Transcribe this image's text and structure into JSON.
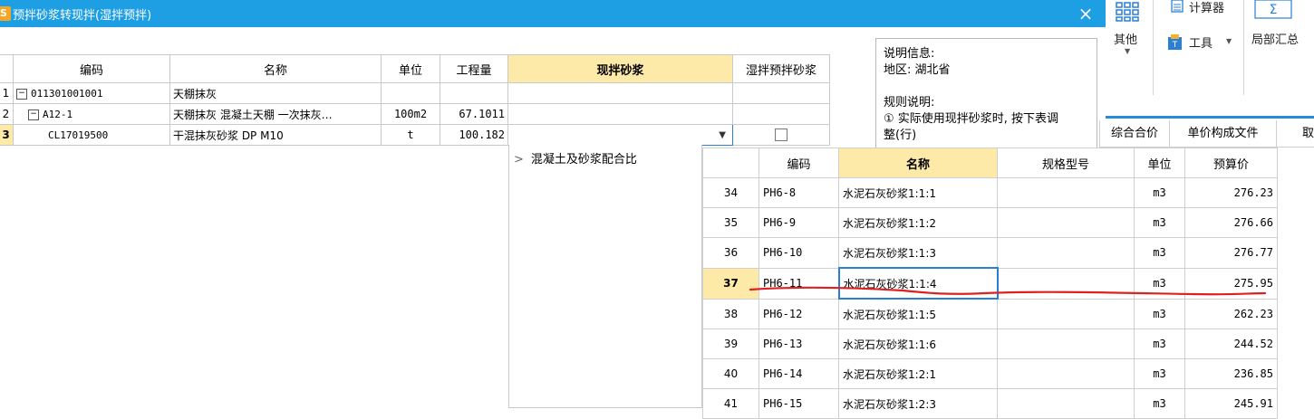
{
  "dialog": {
    "title": "预拌砂浆转现拌(湿拌预拌)",
    "close_glyph": "×"
  },
  "ribbon": {
    "other_label": "其他",
    "calculator_label": "计算器",
    "tools_label": "工具",
    "local_summary_label": "局部汇总"
  },
  "tabs": [
    "综合合价",
    "单价构成文件",
    "取"
  ],
  "main_grid": {
    "headers": [
      "编码",
      "名称",
      "单位",
      "工程量",
      "现拌砂浆",
      "湿拌预拌砂浆"
    ],
    "rows": [
      {
        "rownum": "1",
        "tree": "−",
        "code": "011301001001",
        "name": "天棚抹灰",
        "unit": "",
        "qty": "",
        "mortar": "",
        "wet": false
      },
      {
        "rownum": "2",
        "tree": "−",
        "code": "A12-1",
        "name": "天棚抹灰 混凝土天棚 一次抹灰…",
        "unit": "100m2",
        "qty": "67.1011",
        "mortar": "",
        "wet": false
      },
      {
        "rownum": "3",
        "tree": "",
        "code": "CL17019500",
        "name": "干混抹灰砂浆 DP M10",
        "unit": "t",
        "qty": "100.182",
        "mortar": "",
        "wet": true
      }
    ]
  },
  "info_panel": {
    "lines": [
      "说明信息:",
      "地区: 湖北省",
      "",
      "规则说明:",
      "① 实际使用现拌砂浆时, 按下表调",
      "整(行)"
    ]
  },
  "dropdown": {
    "tree_item": "混凝土及砂浆配合比",
    "headers": [
      "",
      "编码",
      "名称",
      "规格型号",
      "单位",
      "预算价"
    ],
    "rows": [
      {
        "no": "34",
        "code": "PH6-8",
        "name": "水泥石灰砂浆1:1:1",
        "spec": "",
        "unit": "m3",
        "price": "276.23"
      },
      {
        "no": "35",
        "code": "PH6-9",
        "name": "水泥石灰砂浆1:1:2",
        "spec": "",
        "unit": "m3",
        "price": "276.66"
      },
      {
        "no": "36",
        "code": "PH6-10",
        "name": "水泥石灰砂浆1:1:3",
        "spec": "",
        "unit": "m3",
        "price": "276.77"
      },
      {
        "no": "37",
        "code": "PH6-11",
        "name": "水泥石灰砂浆1:1:4",
        "spec": "",
        "unit": "m3",
        "price": "275.95",
        "selected": true
      },
      {
        "no": "38",
        "code": "PH6-12",
        "name": "水泥石灰砂浆1:1:5",
        "spec": "",
        "unit": "m3",
        "price": "262.23"
      },
      {
        "no": "39",
        "code": "PH6-13",
        "name": "水泥石灰砂浆1:1:6",
        "spec": "",
        "unit": "m3",
        "price": "244.52"
      },
      {
        "no": "40",
        "code": "PH6-14",
        "name": "水泥石灰砂浆1:2:1",
        "spec": "",
        "unit": "m3",
        "price": "236.85"
      },
      {
        "no": "41",
        "code": "PH6-15",
        "name": "水泥石灰砂浆1:2:3",
        "spec": "",
        "unit": "m3",
        "price": "245.91"
      }
    ]
  },
  "colors": {
    "titlebar": "#1e9ee3",
    "header_highlight": "#fde9a8",
    "selection_border": "#2a7fd4",
    "annotation_red": "#e02020"
  }
}
